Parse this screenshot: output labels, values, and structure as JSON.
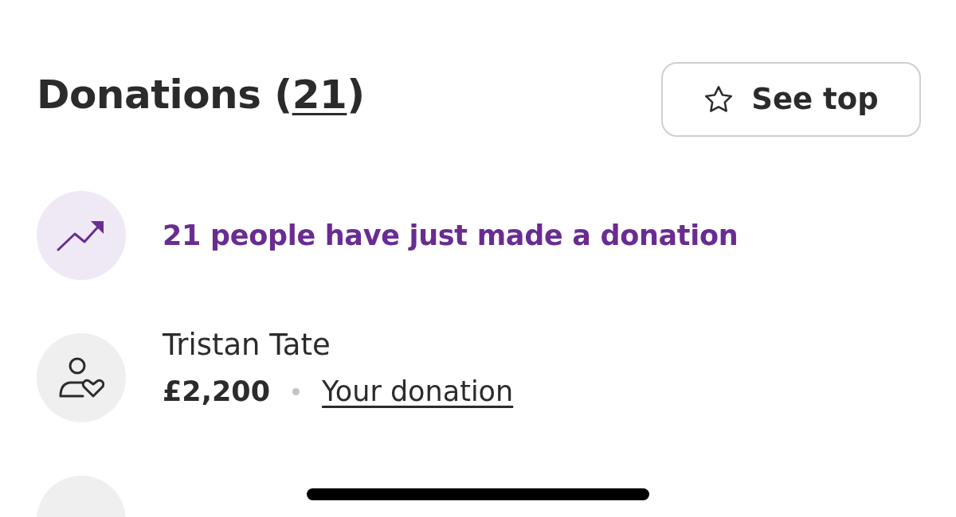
{
  "header": {
    "title_open": "Donations (",
    "count": "21",
    "title_close": ")",
    "button": "See top"
  },
  "items": [
    {
      "kind": "trend",
      "text": "21 people have just made a donation"
    },
    {
      "kind": "donor",
      "name": "Tristan Tate",
      "amount": "£2,200",
      "link": "Your donation"
    },
    {
      "kind": "partial"
    }
  ]
}
